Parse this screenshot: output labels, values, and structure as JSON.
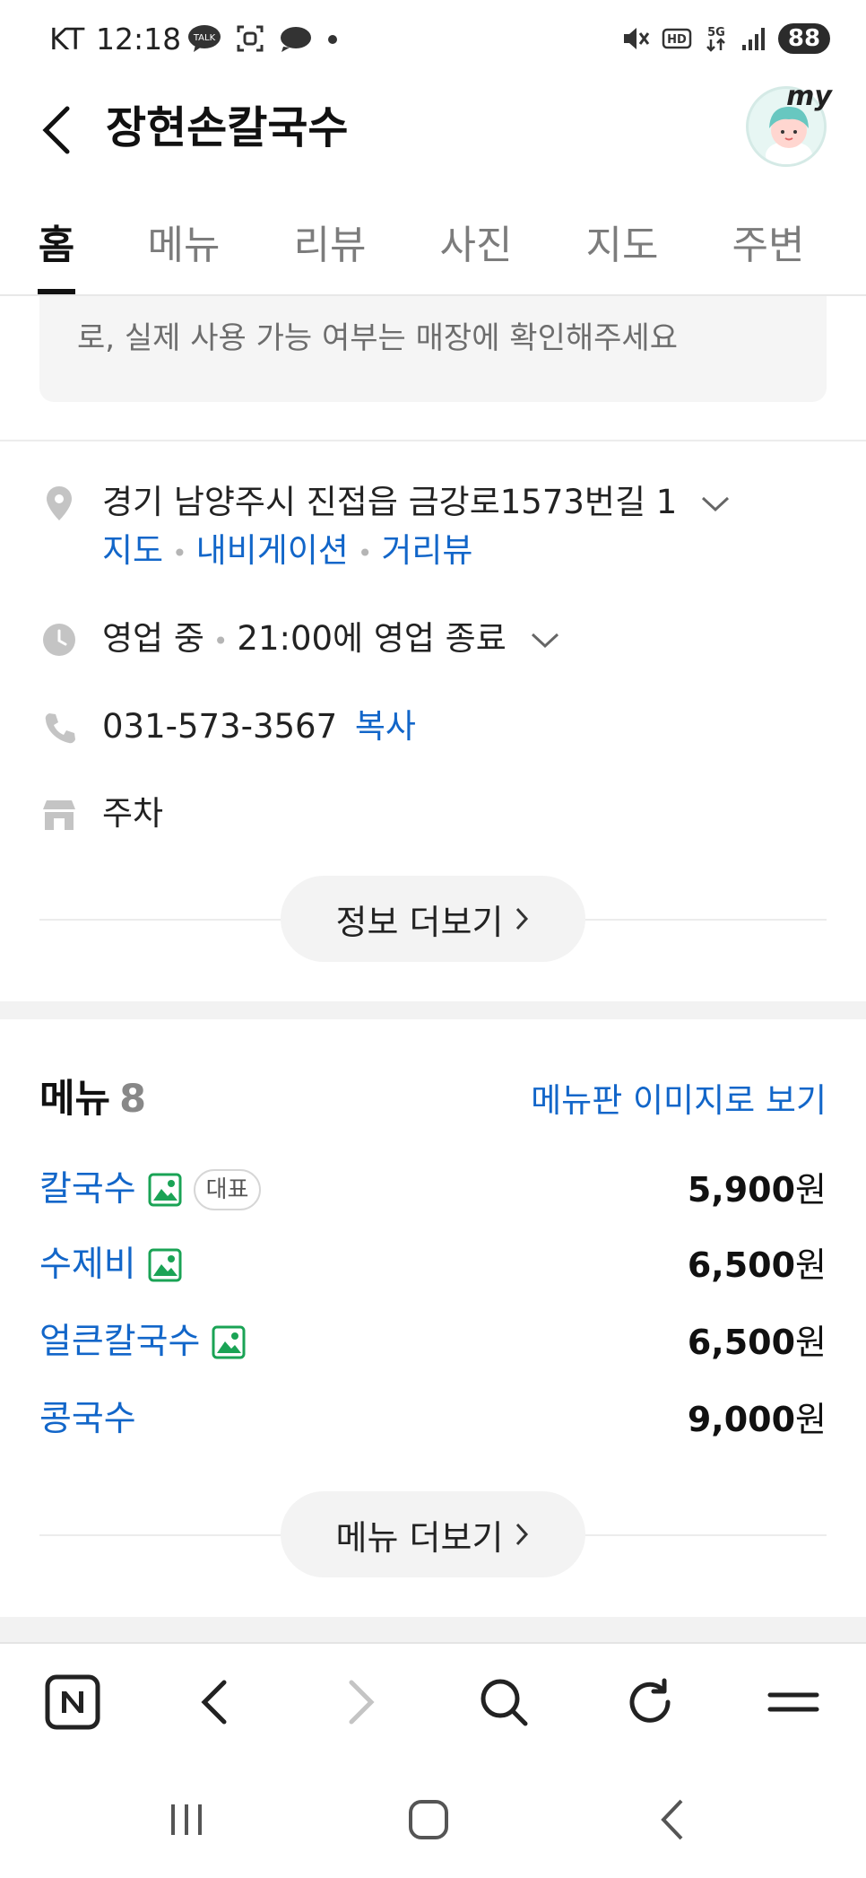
{
  "status_bar": {
    "carrier": "KT",
    "time": "12:18",
    "battery": "88"
  },
  "header": {
    "title": "장현손칼국수",
    "profile_label": "my"
  },
  "tabs": [
    {
      "label": "홈",
      "active": true
    },
    {
      "label": "메뉴",
      "active": false
    },
    {
      "label": "리뷰",
      "active": false
    },
    {
      "label": "사진",
      "active": false
    },
    {
      "label": "지도",
      "active": false
    },
    {
      "label": "주변",
      "active": false
    }
  ],
  "notice": {
    "text": "로, 실제 사용 가능 여부는 매장에 확인해주세요"
  },
  "info": {
    "address": "경기 남양주시 진접읍 금강로1573번길 1",
    "address_links": [
      "지도",
      "내비게이션",
      "거리뷰"
    ],
    "hours_status": "영업 중",
    "hours_detail": "21:00에 영업 종료",
    "phone": "031-573-3567",
    "copy_label": "복사",
    "parking": "주차",
    "more_info_label": "정보 더보기"
  },
  "menu": {
    "heading": "메뉴",
    "count": "8",
    "image_link": "메뉴판 이미지로 보기",
    "items": [
      {
        "name": "칼국수",
        "price": "5,900",
        "unit": "원",
        "has_photo": true,
        "badge": "대표"
      },
      {
        "name": "수제비",
        "price": "6,500",
        "unit": "원",
        "has_photo": true,
        "badge": ""
      },
      {
        "name": "얼큰칼국수",
        "price": "6,500",
        "unit": "원",
        "has_photo": true,
        "badge": ""
      },
      {
        "name": "콩국수",
        "price": "9,000",
        "unit": "원",
        "has_photo": false,
        "badge": ""
      }
    ],
    "more_label": "메뉴 더보기"
  },
  "colors": {
    "link": "#1266c9",
    "photo_icon": "#1aa355",
    "text": "#1a1a1a"
  }
}
